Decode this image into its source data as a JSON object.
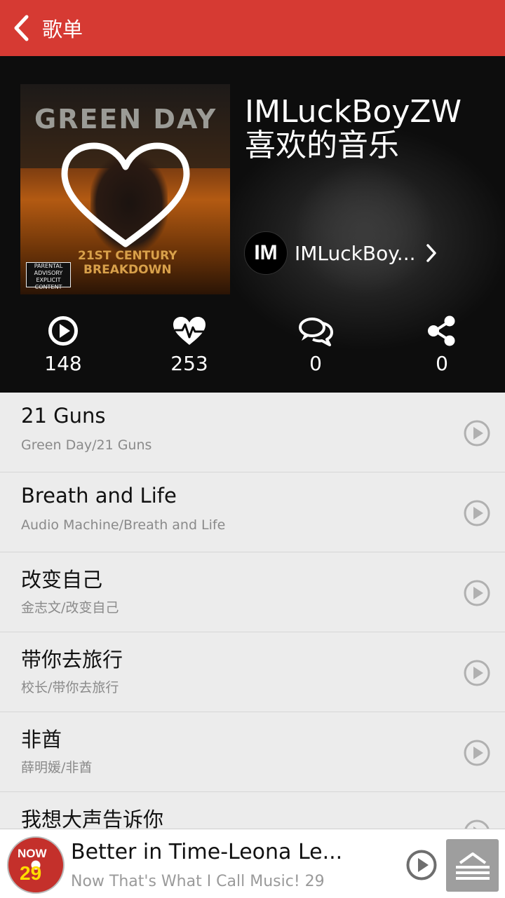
{
  "header": {
    "back_icon": "chevron-left-icon",
    "title": "歌单",
    "color": "#d63a33"
  },
  "playlist": {
    "title": "IMLuckBoyZW\n喜欢的音乐",
    "title_line1": "IMLuckBoyZW",
    "title_line2": "喜欢的音乐",
    "cover_text": "GREEN DAY",
    "cover_subtitle": "21ST CENTURY\nBREAKDOWN",
    "cover_advisory": "PARENTAL ADVISORY EXPLICIT CONTENT",
    "owner_avatar_text": "IM",
    "owner_name": "IMLuckBoy...",
    "stats": [
      {
        "icon": "play-icon",
        "value": "148"
      },
      {
        "icon": "heart-pulse-icon",
        "value": "253"
      },
      {
        "icon": "comment-icon",
        "value": "0"
      },
      {
        "icon": "share-icon",
        "value": "0"
      }
    ]
  },
  "songs": [
    {
      "title": "21 Guns",
      "subtitle": "Green Day/21 Guns"
    },
    {
      "title": "Breath and Life",
      "subtitle": "Audio Machine/Breath and Life"
    },
    {
      "title": "改变自己",
      "subtitle": "金志文/改变自己"
    },
    {
      "title": "带你去旅行",
      "subtitle": "校长/带你去旅行"
    },
    {
      "title": "非酋",
      "subtitle": "薛明媛/非酋"
    },
    {
      "title": "我想大声告诉你",
      "subtitle": ""
    }
  ],
  "now_playing": {
    "song": "Better in Time-Leona Le...",
    "album": "Now That's What I Call Music! 29",
    "disc_text_1": "NOW",
    "disc_text_2": "29"
  }
}
